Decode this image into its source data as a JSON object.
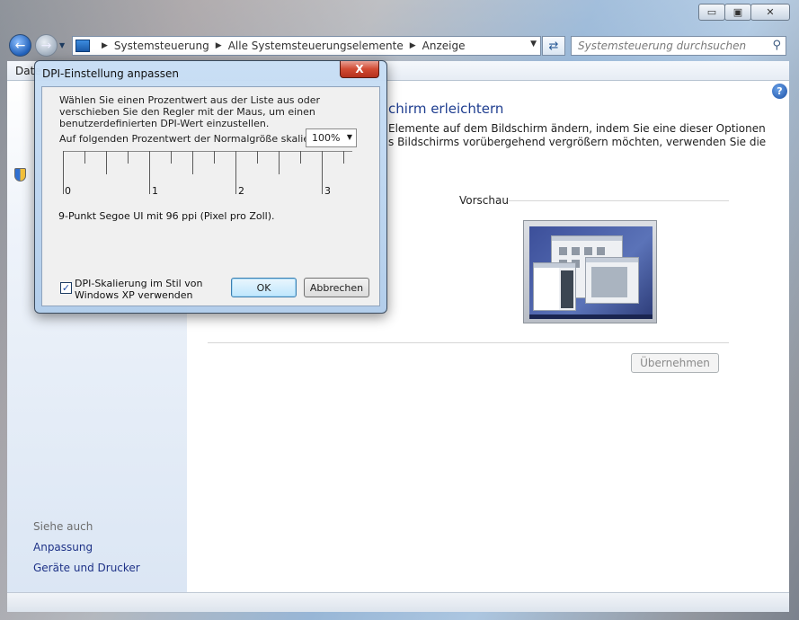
{
  "window": {
    "minimize_symbol": "▭",
    "maximize_symbol": "▣",
    "close_symbol": "✕"
  },
  "address": {
    "crumbs": [
      "Systemsteuerung",
      "Alle Systemsteuerungselemente",
      "Anzeige"
    ],
    "search_placeholder": "Systemsteuerung durchsuchen"
  },
  "menu": {
    "first_item_fragment": "Date"
  },
  "main": {
    "heading_fragment": "chirm erleichtern",
    "desc_line_1": "Elemente auf dem Bildschirm ändern, indem Sie eine dieser Optionen",
    "desc_line_2": "s Bildschirms vorübergehend vergrößern möchten, verwenden Sie die",
    "preview_label": "Vorschau",
    "apply_label": "Übernehmen"
  },
  "see_also": {
    "heading": "Siehe auch",
    "links": [
      "Anpassung",
      "Geräte und Drucker"
    ]
  },
  "dialog": {
    "title": "DPI-Einstellung anpassen",
    "close_symbol": "X",
    "description": "Wählen Sie einen Prozentwert aus der Liste aus oder verschieben Sie den Regler mit der Maus, um einen benutzerdefinierten DPI-Wert einzustellen.",
    "scale_label": "Auf folgenden Prozentwert der Normalgröße skalieren:",
    "scale_value": "100%",
    "ruler_labels": [
      "0",
      "1",
      "2",
      "3"
    ],
    "font_info": "9-Punkt Segoe UI mit 96 ppi (Pixel pro Zoll).",
    "xp_checkbox_checked": true,
    "xp_checkbox_label_line1": "DPI-Skalierung im Stil von",
    "xp_checkbox_label_line2": "Windows XP verwenden",
    "ok_label": "OK",
    "cancel_label": "Abbrechen"
  },
  "colors": {
    "link": "#1e3287",
    "heading": "#1e3d8f",
    "close_red": "#d14a32"
  },
  "icons": {
    "back": "back-arrow-icon",
    "forward": "forward-arrow-icon",
    "refresh": "refresh-icon",
    "search": "magnifier-icon",
    "help": "help-icon",
    "shield": "uac-shield-icon",
    "control_panel": "control-panel-icon"
  }
}
